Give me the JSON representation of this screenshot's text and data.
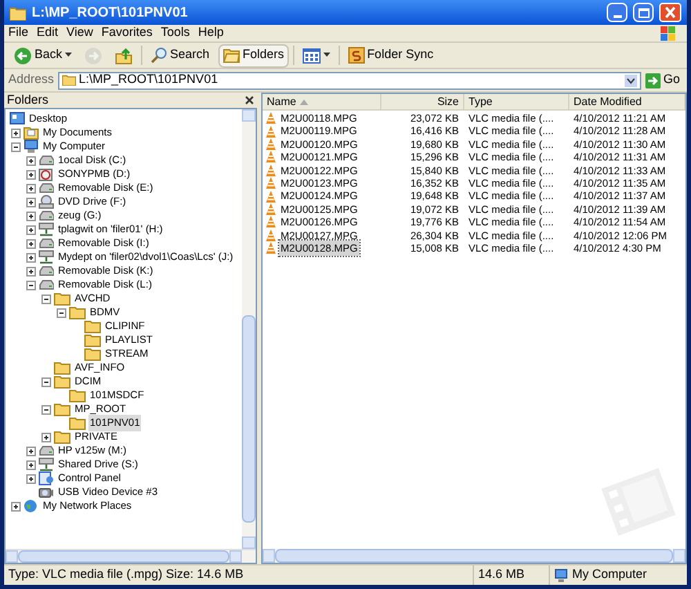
{
  "window": {
    "title": "L:\\MP_ROOT\\101PNV01"
  },
  "menu": [
    "File",
    "Edit",
    "View",
    "Favorites",
    "Tools",
    "Help"
  ],
  "toolbar": [
    {
      "kind": "back",
      "label": "Back",
      "disabled": false,
      "selected": false
    },
    {
      "kind": "forward",
      "disabled": true,
      "selected": false
    },
    {
      "kind": "up",
      "disabled": false,
      "selected": false
    },
    {
      "kind": "search",
      "label": "Search",
      "disabled": false,
      "selected": false
    },
    {
      "kind": "folders",
      "label": "Folders",
      "disabled": false,
      "selected": true
    },
    {
      "kind": "views",
      "disabled": false,
      "selected": false
    },
    {
      "kind": "sync",
      "label": "Folder Sync",
      "disabled": false,
      "selected": false
    }
  ],
  "address": {
    "label": "Address",
    "value": "L:\\MP_ROOT\\101PNV01",
    "go": "Go"
  },
  "folders_pane": {
    "title": "Folders"
  },
  "tree": [
    {
      "label": "Desktop",
      "kind": "desktop",
      "selected": false,
      "children": [
        {
          "label": "My Documents",
          "kind": "documents",
          "expanded": false,
          "selected": false
        },
        {
          "label": "My Computer",
          "kind": "computer",
          "expanded": true,
          "selected": false,
          "children": [
            {
              "label": "1ocal Disk (C:)",
              "kind": "disk",
              "expanded": false,
              "selected": false
            },
            {
              "label": "SONYPMB (D:)",
              "kind": "cd",
              "expanded": false,
              "selected": false
            },
            {
              "label": "Removable Disk (E:)",
              "kind": "disk",
              "expanded": false,
              "selected": false
            },
            {
              "label": "DVD Drive (F:)",
              "kind": "dvd",
              "expanded": false,
              "selected": false
            },
            {
              "label": "zeug (G:)",
              "kind": "disk",
              "expanded": false,
              "selected": false
            },
            {
              "label": "tplagwit on 'filer01' (H:)",
              "kind": "netdrive",
              "expanded": false,
              "selected": false
            },
            {
              "label": "Removable Disk (I:)",
              "kind": "disk",
              "expanded": false,
              "selected": false
            },
            {
              "label": "Mydept on 'filer02\\dvol1\\Coas\\Lcs' (J:)",
              "kind": "netdrive",
              "expanded": false,
              "selected": false
            },
            {
              "label": "Removable Disk (K:)",
              "kind": "disk",
              "expanded": false,
              "selected": false
            },
            {
              "label": "Removable Disk (L:)",
              "kind": "disk",
              "expanded": true,
              "selected": false,
              "children": [
                {
                  "label": "AVCHD",
                  "kind": "folder",
                  "expanded": true,
                  "selected": false,
                  "children": [
                    {
                      "label": "BDMV",
                      "kind": "folder",
                      "expanded": true,
                      "selected": false,
                      "children": [
                        {
                          "label": "CLIPINF",
                          "kind": "folder",
                          "selected": false
                        },
                        {
                          "label": "PLAYLIST",
                          "kind": "folder",
                          "selected": false
                        },
                        {
                          "label": "STREAM",
                          "kind": "folder",
                          "selected": false
                        }
                      ]
                    }
                  ]
                },
                {
                  "label": "AVF_INFO",
                  "kind": "folder",
                  "selected": false
                },
                {
                  "label": "DCIM",
                  "kind": "folder",
                  "expanded": true,
                  "selected": false,
                  "children": [
                    {
                      "label": "101MSDCF",
                      "kind": "folder",
                      "selected": false
                    }
                  ]
                },
                {
                  "label": "MP_ROOT",
                  "kind": "folder",
                  "expanded": true,
                  "selected": false,
                  "children": [
                    {
                      "label": "101PNV01",
                      "kind": "folder",
                      "selected": true
                    }
                  ]
                },
                {
                  "label": "PRIVATE",
                  "kind": "folder",
                  "expanded": false,
                  "selected": false
                }
              ]
            },
            {
              "label": "HP v125w (M:)",
              "kind": "disk",
              "expanded": false,
              "selected": false
            },
            {
              "label": "Shared Drive (S:)",
              "kind": "netdrive",
              "expanded": false,
              "selected": false
            },
            {
              "label": "Control Panel",
              "kind": "control",
              "expanded": false,
              "selected": false
            },
            {
              "label": "USB Video Device #3",
              "kind": "camera",
              "selected": false
            }
          ]
        },
        {
          "label": "My Network Places",
          "kind": "network",
          "expanded": false,
          "selected": false
        }
      ]
    }
  ],
  "columns": [
    {
      "label": "Name",
      "sorted": true
    },
    {
      "label": "Size",
      "sorted": false
    },
    {
      "label": "Type",
      "sorted": false
    },
    {
      "label": "Date Modified",
      "sorted": false
    }
  ],
  "files": [
    {
      "name": "M2U00118.MPG",
      "size": "23,072 KB",
      "type": "VLC media file (....",
      "date": "4/10/2012 11:21 AM",
      "selected": false
    },
    {
      "name": "M2U00119.MPG",
      "size": "16,416 KB",
      "type": "VLC media file (....",
      "date": "4/10/2012 11:28 AM",
      "selected": false
    },
    {
      "name": "M2U00120.MPG",
      "size": "19,680 KB",
      "type": "VLC media file (....",
      "date": "4/10/2012 11:30 AM",
      "selected": false
    },
    {
      "name": "M2U00121.MPG",
      "size": "15,296 KB",
      "type": "VLC media file (....",
      "date": "4/10/2012 11:31 AM",
      "selected": false
    },
    {
      "name": "M2U00122.MPG",
      "size": "15,840 KB",
      "type": "VLC media file (....",
      "date": "4/10/2012 11:33 AM",
      "selected": false
    },
    {
      "name": "M2U00123.MPG",
      "size": "16,352 KB",
      "type": "VLC media file (....",
      "date": "4/10/2012 11:35 AM",
      "selected": false
    },
    {
      "name": "M2U00124.MPG",
      "size": "19,648 KB",
      "type": "VLC media file (....",
      "date": "4/10/2012 11:37 AM",
      "selected": false
    },
    {
      "name": "M2U00125.MPG",
      "size": "19,072 KB",
      "type": "VLC media file (....",
      "date": "4/10/2012 11:39 AM",
      "selected": false
    },
    {
      "name": "M2U00126.MPG",
      "size": "19,776 KB",
      "type": "VLC media file (....",
      "date": "4/10/2012 11:54 AM",
      "selected": false
    },
    {
      "name": "M2U00127.MPG",
      "size": "26,304 KB",
      "type": "VLC media file (....",
      "date": "4/10/2012 12:06 PM",
      "selected": false
    },
    {
      "name": "M2U00128.MPG",
      "size": "15,008 KB",
      "type": "VLC media file (....",
      "date": "4/10/2012 4:30 PM",
      "selected": true
    }
  ],
  "status_bar": {
    "info": "Type: VLC media file (.mpg) Size: 14.6 MB",
    "size": "14.6 MB",
    "zone": "My Computer"
  }
}
